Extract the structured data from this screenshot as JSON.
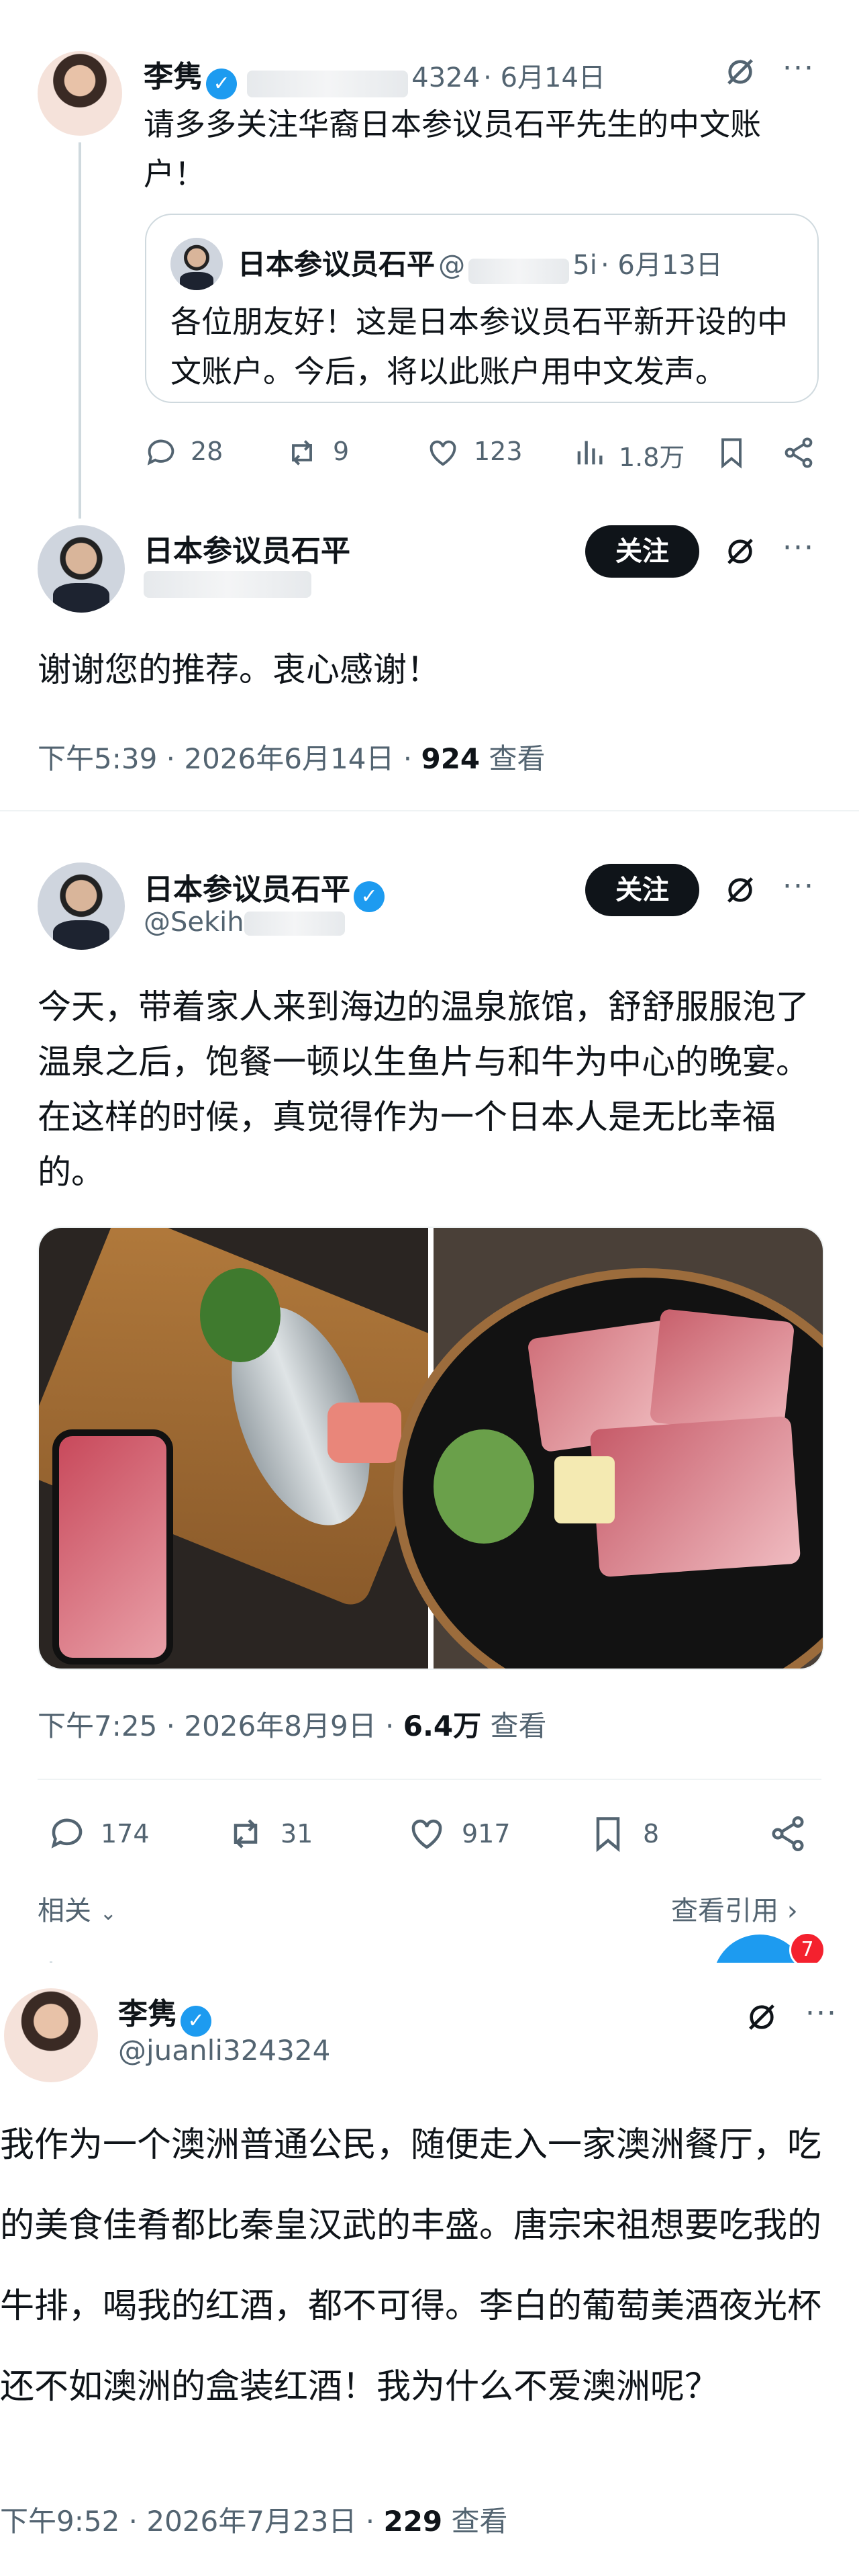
{
  "post1": {
    "author": "李隽",
    "handle": "@juanli324324",
    "handle_visible": "4324",
    "date": "· 6月14日",
    "text": "请多多关注华裔日本参议员石平先生的中文账户！",
    "quote": {
      "author": "日本参议员石平",
      "handle_prefix": "@",
      "handle_suffix": "5i",
      "date": "· 6月13日",
      "text": "各位朋友好！这是日本参议员石平新开设的中文账户。今后，将以此账户用中文发声。"
    },
    "stats": {
      "replies": "28",
      "reposts": "9",
      "likes": "123",
      "views": "1.8万"
    }
  },
  "reply": {
    "author": "日本参议员石平",
    "follow_label": "关注",
    "text": "谢谢您的推荐。衷心感谢！",
    "time": "下午5:39 · 2026年6月14日 · ",
    "views_count": "924",
    "views_label": " 查看"
  },
  "post2": {
    "author": "日本参议员石平",
    "handle": "@Sekihei5i",
    "handle_visible": "@Sekih",
    "follow_label": "关注",
    "text": "今天，带着家人来到海边的温泉旅馆，舒舒服服泡了温泉之后，饱餐一顿以生鱼片与和牛为中心的晚宴。在这样的时候，真觉得作为一个日本人是无比幸福的。",
    "time": "下午7:25 · 2026年8月9日 · ",
    "views_count": "6.4万",
    "views_label": " 查看",
    "stats": {
      "replies": "174",
      "reposts": "31",
      "likes": "917",
      "bookmarks": "8"
    },
    "related_label": "相关",
    "quotes_label": "查看引用",
    "notification_count": "7"
  },
  "post3": {
    "author": "李隽",
    "handle": "@juanli324324",
    "text": "我作为一个澳洲普通公民，随便走入一家澳洲餐厅，吃的美食佳肴都比秦皇汉武的丰盛。唐宗宋祖想要吃我的牛排，喝我的红酒，都不可得。李白的葡萄美酒夜光杯还不如澳洲的盒装红酒！我为什么不爱澳洲呢？",
    "time": "下午9:52 · 2026年7月23日 · ",
    "views_count": "229",
    "views_label": " 查看"
  },
  "colors": {
    "accent": "#1d9bf0",
    "text": "#0f1419",
    "muted": "#536471",
    "divider": "#eff3f4"
  }
}
